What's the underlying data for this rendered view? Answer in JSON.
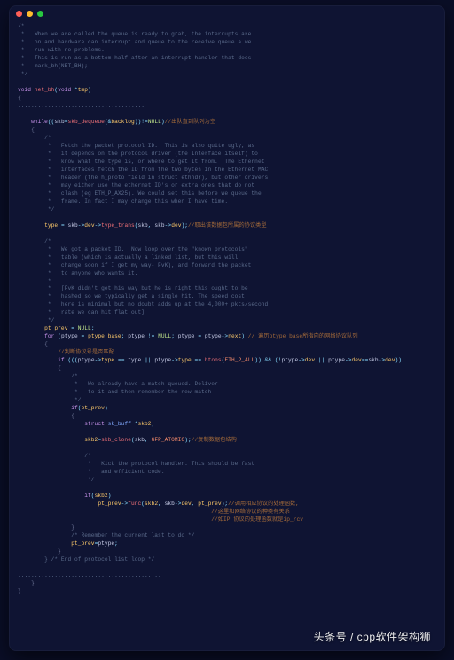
{
  "window": {
    "dots": [
      "#ff5f57",
      "#febc2e",
      "#28c840"
    ]
  },
  "watermark": "头条号 / cpp软件架构狮",
  "code": {
    "c01": "/*",
    "c02": " *   When we are called the queue is ready to grab, the interrupts are",
    "c03": " *   on and hardware can interrupt and queue to the receive queue a we",
    "c04": " *   run with no problems.",
    "c05": " *   This is run as a bottom half after an interrupt handler that does",
    "c06": " *   mark_bh(NET_BH);",
    "c07": " */",
    "kw_void": "void",
    "fn_netbh": "net_bh",
    "sig_l": "(",
    "sig_void": "void",
    "sig_star": " *",
    "sig_tmp": "tmp",
    "sig_r": ")",
    "obr": "{",
    "dots1": "......................................",
    "kw_while": "while",
    "wl": "((",
    "id_skb": "skb",
    "eq": "=",
    "fn_deq": "skb_dequeue",
    "amp": "(&",
    "id_back": "backlog",
    "wpr": "))!=",
    "nl_null": "NULL",
    "wr": ")",
    "wcmt": "//出队直到队列为空",
    "c10": "/*",
    "c11": " *   Fetch the packet protocol ID.  This is also quite ugly, as",
    "c12": " *   it depends on the protocol driver (the interface itself) to",
    "c13": " *   know what the type is, or where to get it from.  The Ethernet",
    "c14": " *   interfaces fetch the ID from the two bytes in the Ethernet MAC",
    "c15": " *   header (the h_proto field in struct ethhdr), but other drivers",
    "c16": " *   may either use the ethernet ID's or extra ones that do not",
    "c17": " *   clash (eg ETH_P_AX25). We could set this before we queue the",
    "c18": " *   frame. In fact I may change this when I have time.",
    "c19": " */",
    "id_type": "type",
    "arrow": "->",
    "id_dev": "dev",
    "fn_tt": "type_trans",
    "tcmt": "//取出该数据包所属的协议类型",
    "c20": "/*",
    "c21": " *   We got a packet ID.  Now loop over the \"known protocols\"",
    "c22": " *   table (which is actually a linked list, but this will",
    "c23": " *   change soon if I get my way- FvK), and forward the packet",
    "c24": " *   to anyone who wants it.",
    "c25": " *",
    "c26": " *   [FvK didn't get his way but he is right this ought to be",
    "c27": " *   hashed so we typically get a single hit. The speed cost",
    "c28": " *   here is minimal but no doubt adds up at the 4,000+ pkts/second",
    "c29": " *   rate we can hit flat out]",
    "c30": " */",
    "id_ptprev": "pt_prev",
    "kw_for": "for",
    "id_ptype": "ptype",
    "id_ptbase": "ptype_base",
    "ne": " != ",
    "id_next": "next",
    "fcmt": " 遍历ptype_base所指向的网络协议队列",
    "cmatch": "//判断协议号是否匹配",
    "kw_if": "if",
    "ic1l": " (((",
    "mc_type": "type",
    "eqeq": " == ",
    "or": " || ",
    "fn_htons": "htons",
    "cn_ethp": "ETH_P_ALL",
    "ic1m": ")) && (!",
    "ic1r": "))",
    "c40": "/*",
    "c41": " *   We already have a match queued. Deliver",
    "c42": " *   to it and then remember the new match",
    "c43": " */",
    "kw_struct": "struct",
    "ty_skbuff": "sk_buff",
    "id_skb2": "skb2",
    "fn_clone": "skb_clone",
    "cn_gfp": "GFP_ATOMIC",
    "clonecmt": "//复制数据包结构",
    "c50": "/*",
    "c51": " *   Kick the protocol handler. This should be fast",
    "c52": " *   and efficient code.",
    "c53": " */",
    "fn_func": "func",
    "funccmt1": "//调用相应协议的处理函数,",
    "funccmt2": "//这里和网络协议的种类有关系",
    "funccmt3": "//如IP 协议的处理函数就是ip_rcv",
    "cbr": "}",
    "c60": "/* Remember the current last to do */",
    "c61": "} /* End of protocol list loop */",
    "dots2": "...........................................",
    "semi": ";",
    "comma": ", ",
    "slashslash": "//"
  }
}
